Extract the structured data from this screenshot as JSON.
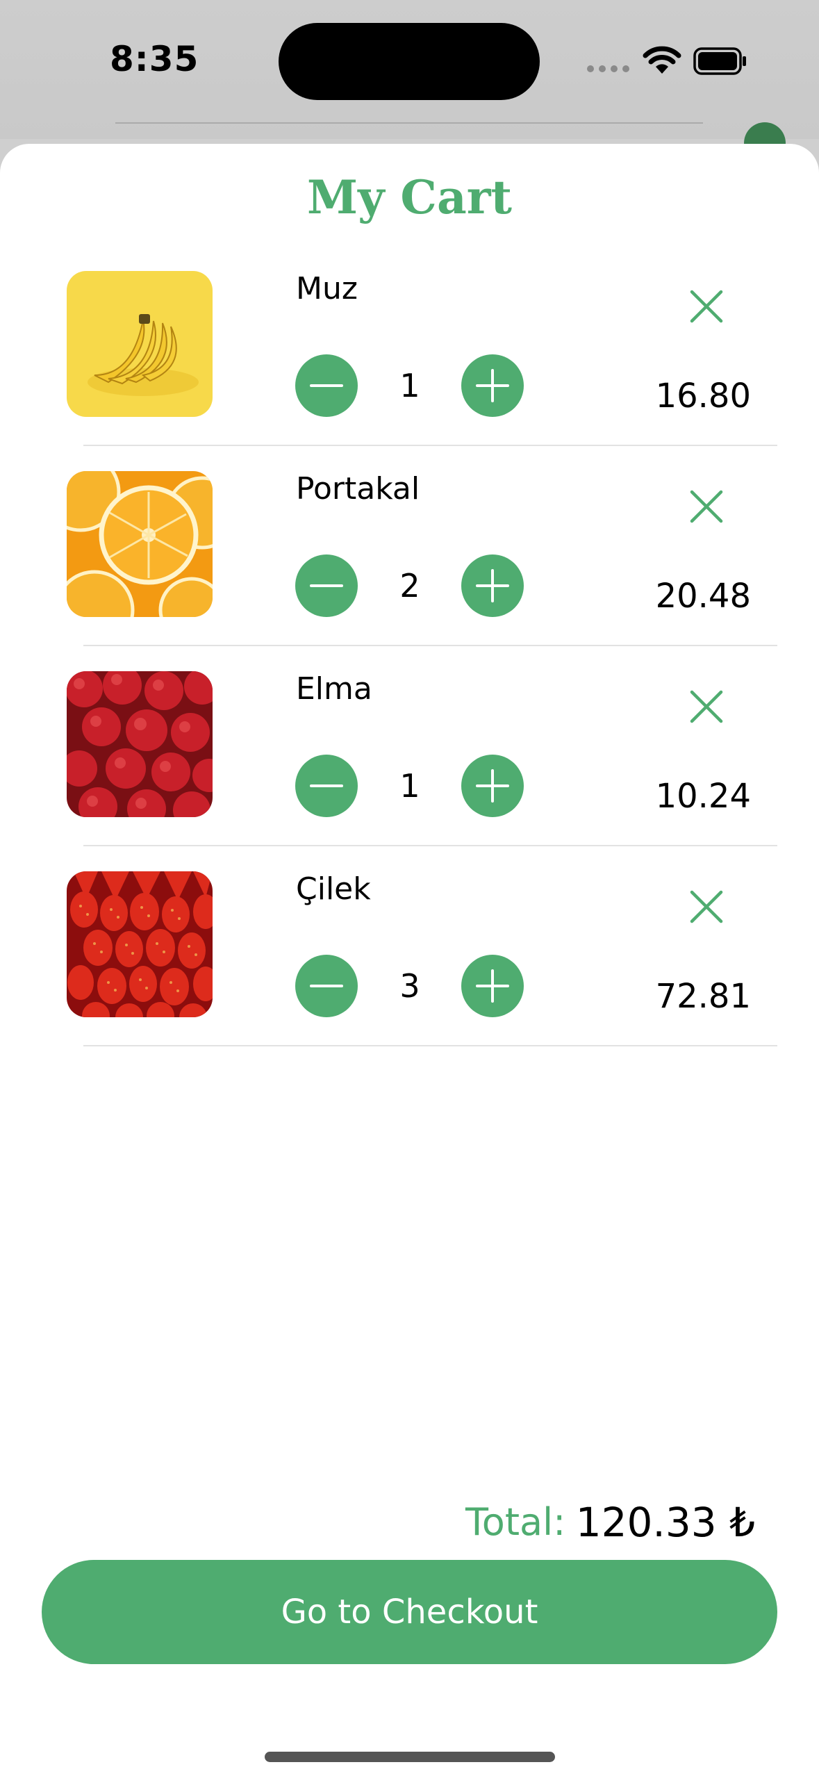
{
  "status_bar": {
    "time": "8:35"
  },
  "cart": {
    "title": "My Cart",
    "items": [
      {
        "name": "Muz",
        "quantity": "1",
        "price": "16.80",
        "image": "banana-image"
      },
      {
        "name": "Portakal",
        "quantity": "2",
        "price": "20.48",
        "image": "orange-image"
      },
      {
        "name": "Elma",
        "quantity": "1",
        "price": "10.24",
        "image": "apple-image"
      },
      {
        "name": "Çilek",
        "quantity": "3",
        "price": "72.81",
        "image": "strawberry-image"
      }
    ],
    "total_label": "Total:",
    "total_value": "120.33 ₺",
    "checkout_label": "Go to Checkout"
  },
  "icons": {
    "decrease": "minus-icon",
    "increase": "plus-icon",
    "remove": "close-icon"
  },
  "colors": {
    "accent": "#4fac70",
    "background": "#ffffff",
    "status_bar": "#cdcdcd"
  }
}
